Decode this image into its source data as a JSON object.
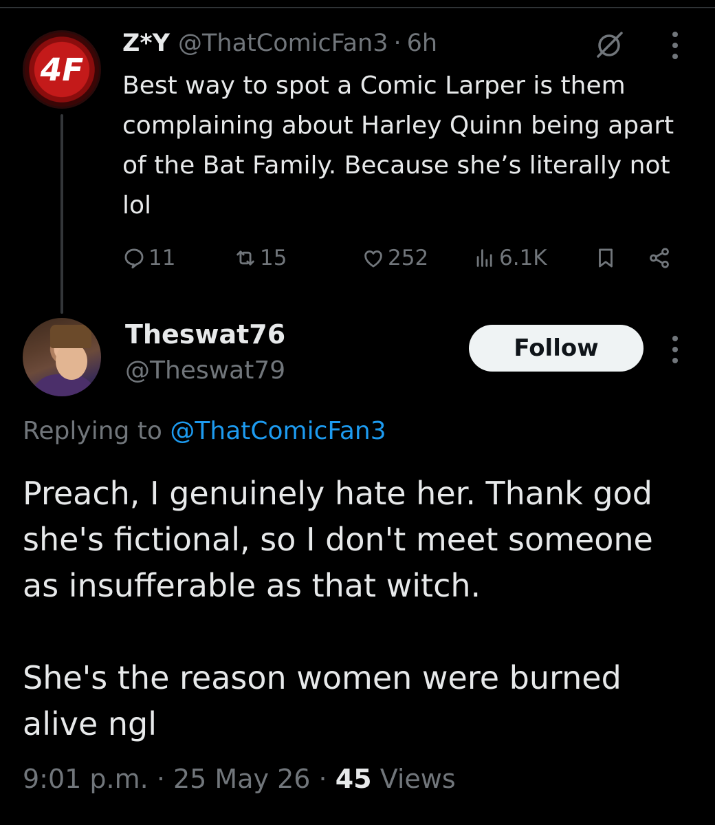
{
  "parent": {
    "avatar_text": "4F",
    "name": "Z*Y",
    "handle": "@ThatComicFan3",
    "separator": "·",
    "time": "6h",
    "text": "Best way to spot a Comic Larper is them complaining about Harley Quinn being apart of the Bat Family. Because she’s literally not lol",
    "actions": {
      "replies": "11",
      "reposts": "15",
      "likes": "252",
      "views": "6.1K"
    },
    "icons": [
      "grok-icon",
      "more-icon",
      "reply-icon",
      "repost-icon",
      "like-icon",
      "views-icon",
      "bookmark-icon",
      "share-icon"
    ]
  },
  "reply": {
    "name": "Theswat76",
    "handle": "@Theswat79",
    "follow_label": "Follow",
    "replying_prefix": "Replying to ",
    "replying_handle": "@ThatComicFan3",
    "text_line1": "Preach, I genuinely hate her. Thank god she's fictional, so I don't meet someone as insufferable as that witch.",
    "text_line2": "She's the reason women were burned alive ngl",
    "time": "9:01 p.m.",
    "separator": "·",
    "date": "25 May 26",
    "views_count": "45",
    "views_label": "Views"
  },
  "colors": {
    "background": "#000000",
    "text": "#e7e9ea",
    "muted": "#71767b",
    "link": "#1d9bf0",
    "follow_bg": "#eff3f4"
  }
}
